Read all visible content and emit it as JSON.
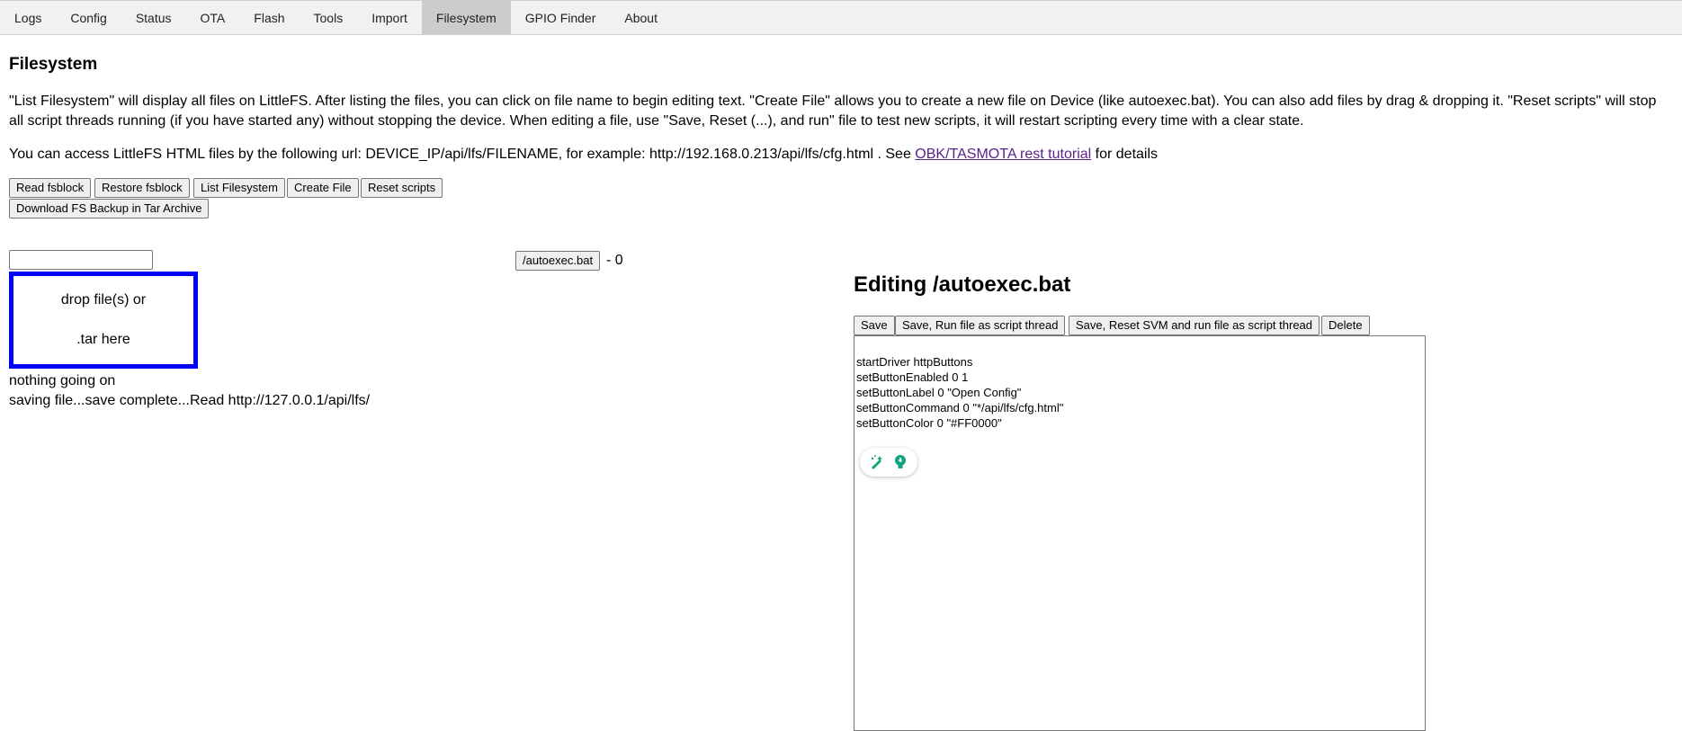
{
  "tabs": [
    {
      "label": "Logs",
      "active": false
    },
    {
      "label": "Config",
      "active": false
    },
    {
      "label": "Status",
      "active": false
    },
    {
      "label": "OTA",
      "active": false
    },
    {
      "label": "Flash",
      "active": false
    },
    {
      "label": "Tools",
      "active": false
    },
    {
      "label": "Import",
      "active": false
    },
    {
      "label": "Filesystem",
      "active": true
    },
    {
      "label": "GPIO Finder",
      "active": false
    },
    {
      "label": "About",
      "active": false
    }
  ],
  "page": {
    "title": "Filesystem",
    "description": "\"List Filesystem\" will display all files on LittleFS. After listing the files, you can click on file name to begin editing text. \"Create File\" allows you to create a new file on Device (like autoexec.bat). You can also add files by drag & dropping it. \"Reset scripts\" will stop all script threads running (if you have started any) without stopping the device. When editing a file, use \"Save, Reset (...), and run\" file to test new scripts, it will restart scripting every time with a clear state.",
    "access_prefix": "You can access LittleFS HTML files by the following url: DEVICE_IP/api/lfs/FILENAME, for example: http://192.168.0.213/api/lfs/cfg.html . See",
    "access_link": "OBK/TASMOTA rest tutorial",
    "access_suffix": "for details"
  },
  "toolbar": {
    "read_fsblock": "Read fsblock",
    "restore_fsblock": "Restore fsblock",
    "list_filesystem": "List Filesystem",
    "create_file": "Create File",
    "reset_scripts": "Reset scripts",
    "download_backup": "Download FS Backup in Tar Archive"
  },
  "new_file": {
    "value": "",
    "placeholder": ""
  },
  "dropzone": {
    "line1": "drop file(s) or",
    "line2": ".tar here"
  },
  "status": {
    "line1": "nothing going on",
    "line2": "saving file...save complete...Read http://127.0.0.1/api/lfs/"
  },
  "file_list": [
    {
      "name": "/autoexec.bat",
      "size": "- 0"
    }
  ],
  "editor": {
    "title": "Editing /autoexec.bat",
    "save": "Save",
    "save_run": "Save, Run file as script thread",
    "save_reset_run": "Save, Reset SVM and run file as script thread",
    "delete": "Delete",
    "content": "startDriver httpButtons\nsetButtonEnabled 0 1\nsetButtonLabel 0 \"Open Config\"\nsetButtonCommand 0 \"*/api/lfs/cfg.html\"\nsetButtonColor 0 \"#FF0000\""
  },
  "extension_icons": [
    "magic-wand-icon",
    "lightbulb-icon"
  ],
  "colors": {
    "tab_bar": "#f1f1f1",
    "active_tab": "#cccccc",
    "dropzone_border": "#0000ff",
    "link": "#5b1f8a",
    "extension_icon": "#10a37f"
  }
}
